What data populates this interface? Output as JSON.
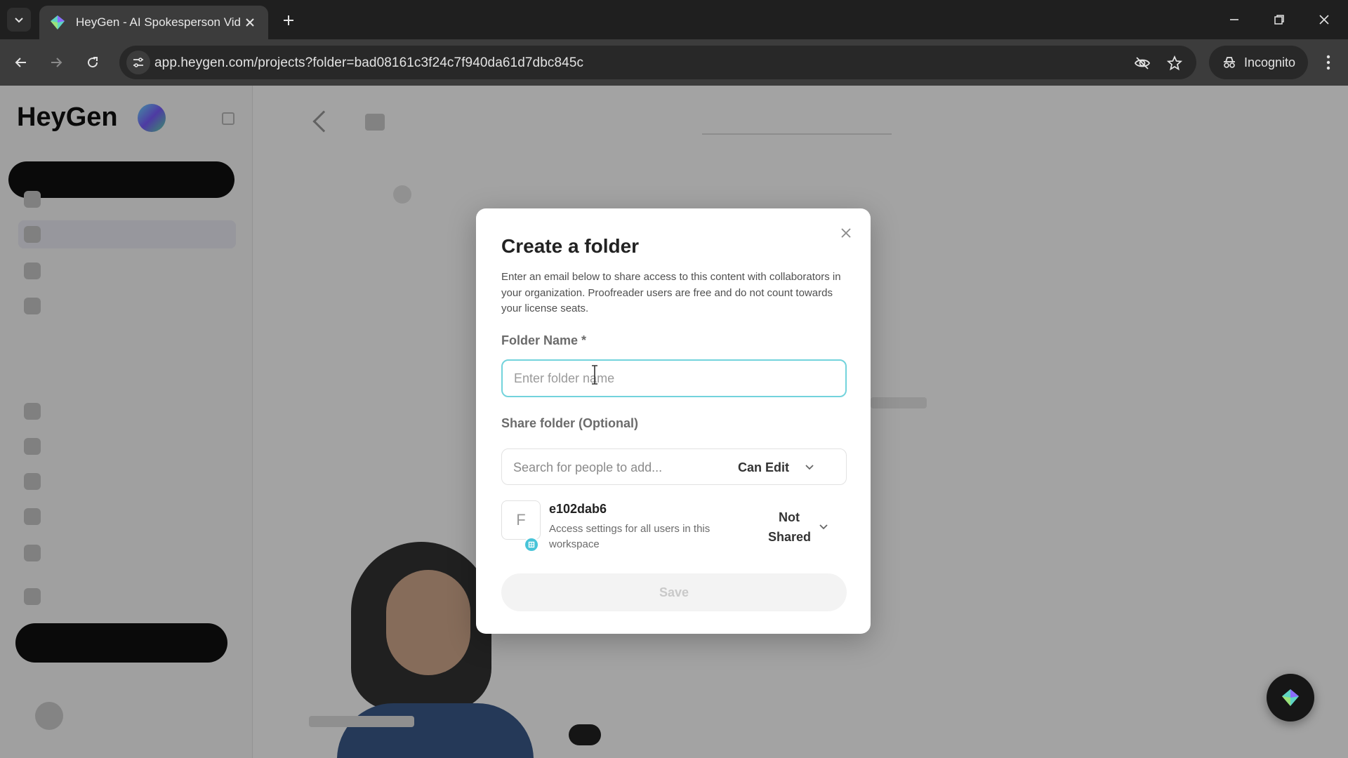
{
  "browser": {
    "tab_title": "HeyGen - AI Spokesperson Vid",
    "url": "app.heygen.com/projects?folder=bad08161c3f24c7f940da61d7dbc845c",
    "incognito_label": "Incognito"
  },
  "page": {
    "logo_text": "HeyGen"
  },
  "modal": {
    "title": "Create a folder",
    "description": "Enter an email below to share access to this content with collaborators in your organization. Proofreader users are free and do not count towards your license seats.",
    "folder_name_label": "Folder Name *",
    "folder_name_placeholder": "Enter folder name",
    "folder_name_value": "",
    "share_label": "Share folder (Optional)",
    "search_placeholder": "Search for people to add...",
    "permission": "Can Edit",
    "member": {
      "initial": "F",
      "name": "e102dab6",
      "description": "Access settings for all users in this workspace",
      "permission": "Not Shared"
    },
    "save_label": "Save"
  },
  "icons": {
    "accent": "#73d3dc",
    "badge": "#48c4d8"
  }
}
